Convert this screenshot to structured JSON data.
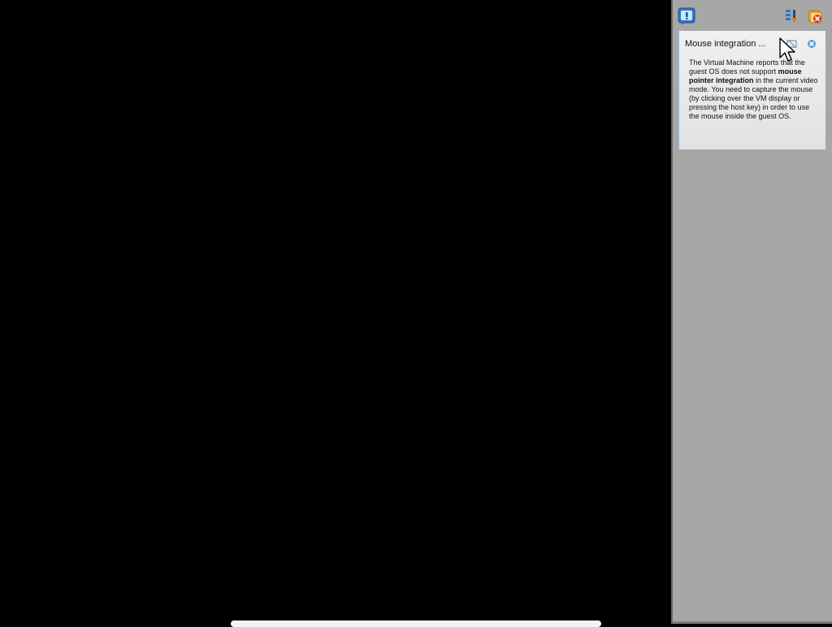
{
  "notification": {
    "title": "Mouse integration ...",
    "body_part1": "The Virtual Machine reports that the guest OS does not support ",
    "body_bold": "mouse pointer integration",
    "body_part2": " in the current video mode. You need to capture the mouse (by clicking over the VM display or pressing the host key) in order to use the mouse inside the guest OS."
  },
  "icons": {
    "notify": "notification-center-icon",
    "sort": "sort-icon",
    "close_all": "close-all-icon",
    "dont_show": "do-not-show-again-icon",
    "dismiss": "close-icon",
    "cursor": "mouse-pointer-icon"
  },
  "colors": {
    "vm_background": "#000000",
    "panel_background": "#a7a7a7",
    "card_accent": "#8fb8df"
  }
}
